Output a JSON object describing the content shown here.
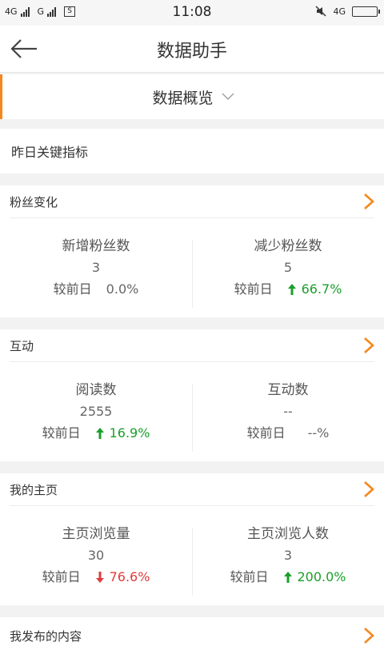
{
  "status_bar": {
    "network1": "4G",
    "network2": "G",
    "time": "11:08",
    "net_right": "4G"
  },
  "header": {
    "title": "数据助手"
  },
  "overview": {
    "label": "数据概览"
  },
  "key_metrics_label": "昨日关键指标",
  "compare_label": "较前日",
  "sections": [
    {
      "title": "粉丝变化",
      "metrics": [
        {
          "label": "新增粉丝数",
          "value": "3",
          "change": "0.0%",
          "trend": "none"
        },
        {
          "label": "减少粉丝数",
          "value": "5",
          "change": "66.7%",
          "trend": "up"
        }
      ]
    },
    {
      "title": "互动",
      "metrics": [
        {
          "label": "阅读数",
          "value": "2555",
          "change": "16.9%",
          "trend": "up"
        },
        {
          "label": "互动数",
          "value": "--",
          "change": "--%",
          "trend": "none"
        }
      ]
    },
    {
      "title": "我的主页",
      "metrics": [
        {
          "label": "主页浏览量",
          "value": "30",
          "change": "76.6%",
          "trend": "down"
        },
        {
          "label": "主页浏览人数",
          "value": "3",
          "change": "200.0%",
          "trend": "up"
        }
      ]
    },
    {
      "title": "我发布的内容"
    }
  ],
  "colors": {
    "accent": "#f5871f",
    "up": "#1aa02a",
    "down": "#e23b3b"
  }
}
